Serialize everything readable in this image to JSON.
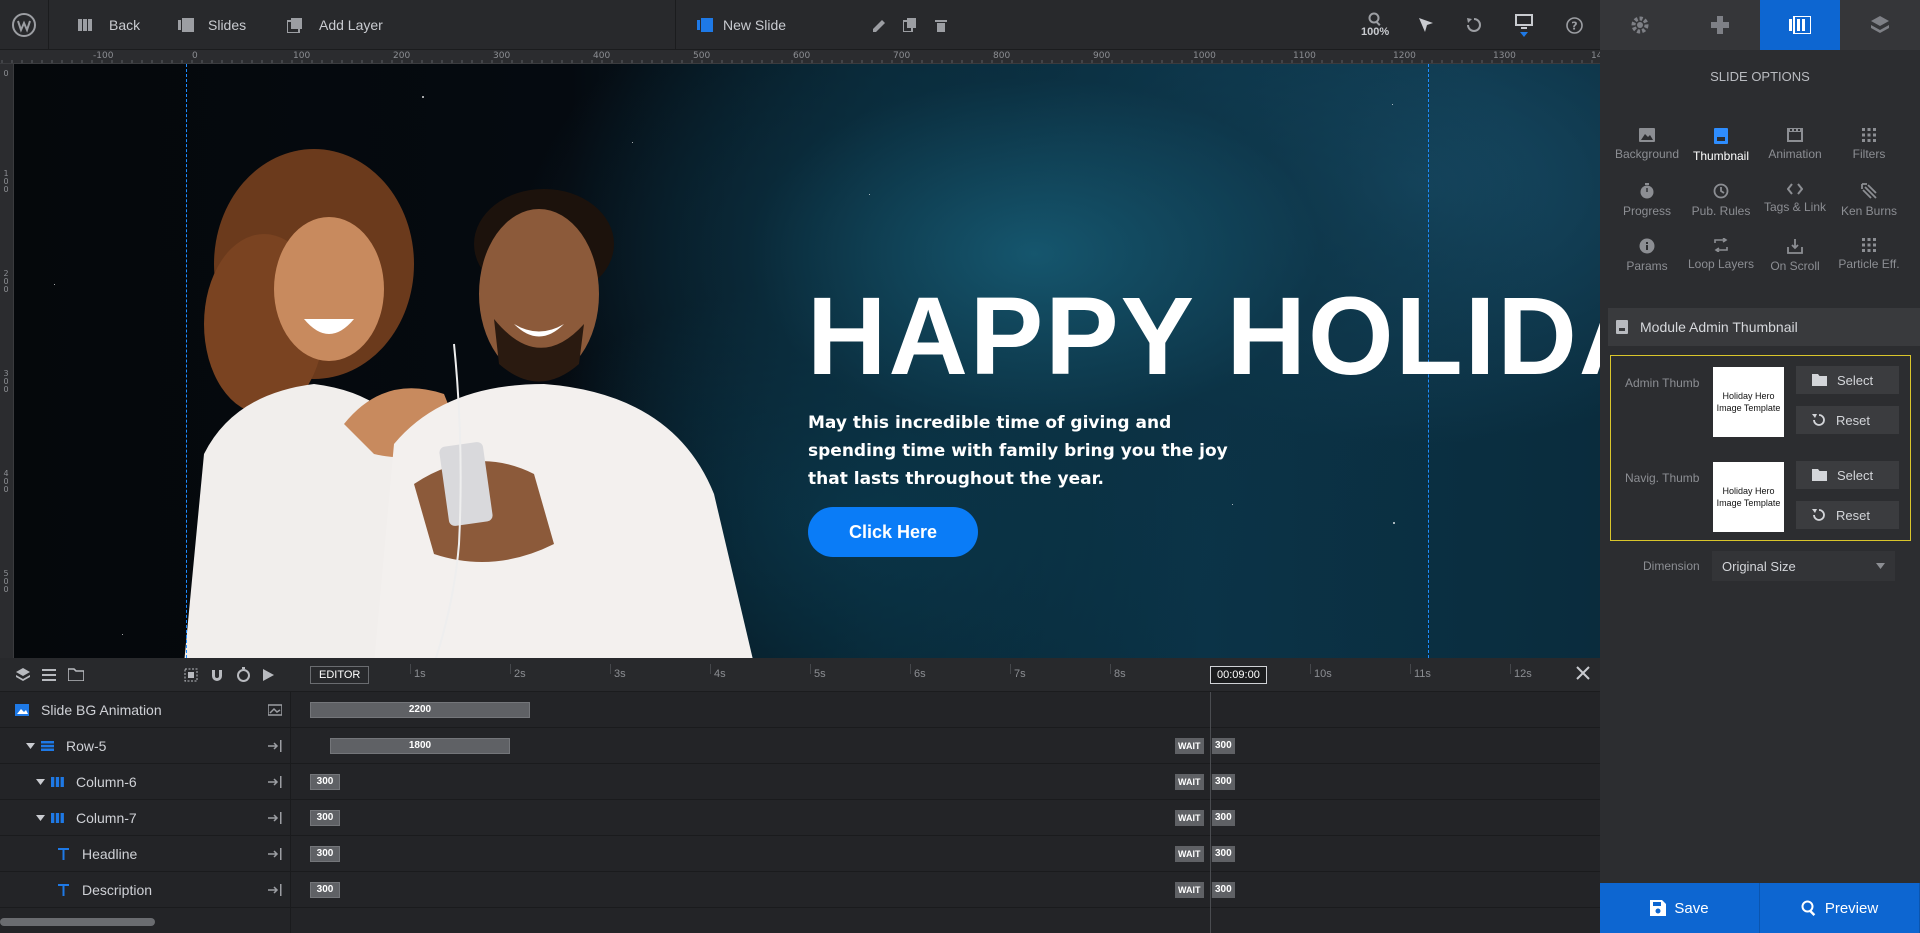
{
  "toolbar": {
    "back": "Back",
    "slides": "Slides",
    "add_layer": "Add Layer",
    "slide_name": "New Slide",
    "zoom": "100%"
  },
  "ruler": {
    "top": [
      "-100",
      "0",
      "100",
      "200",
      "300",
      "400",
      "500",
      "600",
      "700",
      "800",
      "900",
      "1000",
      "1100",
      "1200",
      "1300",
      "14"
    ],
    "left": [
      "0",
      "100",
      "200",
      "300",
      "400",
      "500"
    ]
  },
  "slide": {
    "headline": "HAPPY HOLIDA",
    "description": "May this incredible time of giving and spending time with family bring you the joy that lasts throughout the year.",
    "button": "Click Here"
  },
  "timeline": {
    "editor_label": "EDITOR",
    "seconds": [
      "1s",
      "2s",
      "3s",
      "4s",
      "5s",
      "6s",
      "7s",
      "8s",
      "10s",
      "11s",
      "12s"
    ],
    "current_time": "00:09:00",
    "rows": [
      {
        "name": "Slide BG Animation",
        "bar": "2200"
      },
      {
        "name": "Row-5",
        "bar": "1800",
        "wait": "WAIT",
        "end": "300"
      },
      {
        "name": "Column-6",
        "bar": "300",
        "wait": "WAIT",
        "end": "300"
      },
      {
        "name": "Column-7",
        "bar": "300",
        "wait": "WAIT",
        "end": "300"
      },
      {
        "name": "Headline",
        "bar": "300",
        "wait": "WAIT",
        "end": "300"
      },
      {
        "name": "Description",
        "bar": "300",
        "wait": "WAIT",
        "end": "300"
      }
    ]
  },
  "panel": {
    "title": "SLIDE OPTIONS",
    "options": [
      {
        "label": "Background",
        "icon": "image-icon"
      },
      {
        "label": "Thumbnail",
        "icon": "thumbnail-icon"
      },
      {
        "label": "Animation",
        "icon": "film-icon"
      },
      {
        "label": "Filters",
        "icon": "filters-icon"
      },
      {
        "label": "Progress",
        "icon": "stopwatch-icon"
      },
      {
        "label": "Pub. Rules",
        "icon": "clock-icon"
      },
      {
        "label": "Tags & Link",
        "icon": "code-icon"
      },
      {
        "label": "Ken Burns",
        "icon": "ken-burns-icon"
      },
      {
        "label": "Params",
        "icon": "info-icon"
      },
      {
        "label": "Loop Layers",
        "icon": "loop-icon"
      },
      {
        "label": "On Scroll",
        "icon": "scroll-icon"
      },
      {
        "label": "Particle Eff.",
        "icon": "particles-icon"
      }
    ],
    "section": "Module Admin Thumbnail",
    "admin_thumb": "Admin Thumb",
    "navig_thumb": "Navig. Thumb",
    "thumb_text": "Holiday Hero Image Template",
    "select": "Select",
    "reset": "Reset",
    "dimension_label": "Dimension",
    "dimension_value": "Original Size",
    "save": "Save",
    "preview": "Preview"
  },
  "colors": {
    "accent": "#0d66d1",
    "cta": "#0a7cf7",
    "highlight": "#d9c62b"
  }
}
